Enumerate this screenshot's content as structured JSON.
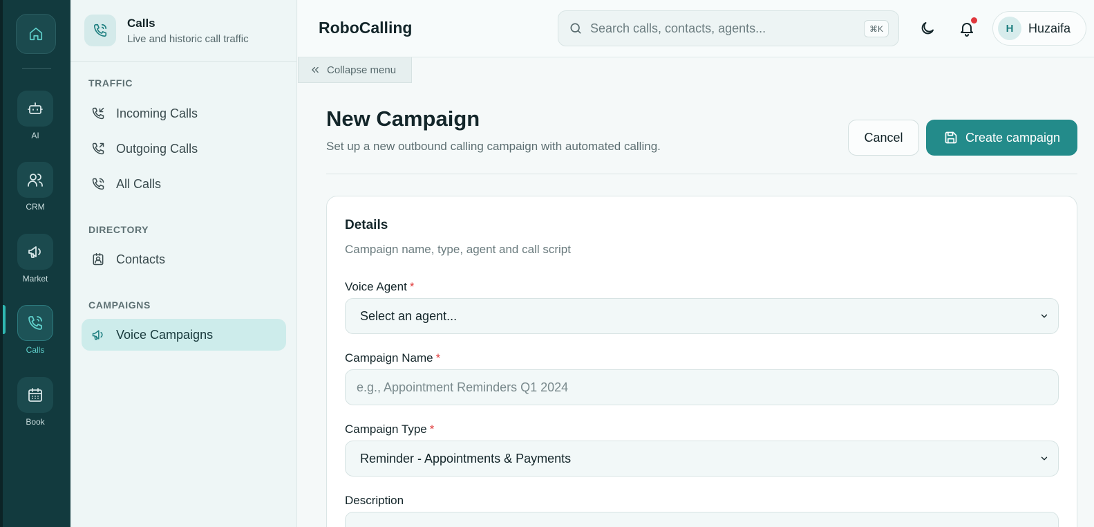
{
  "rail": {
    "items": [
      {
        "label": "",
        "icon": "home-icon"
      },
      {
        "label": "AI",
        "icon": "bot-icon"
      },
      {
        "label": "CRM",
        "icon": "users-icon"
      },
      {
        "label": "Market",
        "icon": "megaphone-icon"
      },
      {
        "label": "Calls",
        "icon": "phone-icon",
        "active": true
      },
      {
        "label": "Book",
        "icon": "calendar-icon"
      }
    ]
  },
  "subnav": {
    "title": "Calls",
    "subtitle": "Live and historic call traffic",
    "sections": [
      {
        "label": "TRAFFIC",
        "items": [
          {
            "label": "Incoming Calls",
            "icon": "phone-incoming-icon"
          },
          {
            "label": "Outgoing Calls",
            "icon": "phone-outgoing-icon"
          },
          {
            "label": "All Calls",
            "icon": "phone-call-icon"
          }
        ]
      },
      {
        "label": "DIRECTORY",
        "items": [
          {
            "label": "Contacts",
            "icon": "contact-icon"
          }
        ]
      },
      {
        "label": "CAMPAIGNS",
        "items": [
          {
            "label": "Voice Campaigns",
            "icon": "megaphone-icon",
            "active": true
          }
        ]
      }
    ]
  },
  "topbar": {
    "app_title": "RoboCalling",
    "search_placeholder": "Search calls, contacts, agents...",
    "search_shortcut": "⌘K",
    "user_initial": "H",
    "user_name": "Huzaifa"
  },
  "collapse_label": "Collapse menu",
  "page": {
    "title": "New Campaign",
    "subtitle": "Set up a new outbound calling campaign with automated calling.",
    "cancel_label": "Cancel",
    "create_label": "Create campaign"
  },
  "details": {
    "title": "Details",
    "subtitle": "Campaign name, type, agent and call script",
    "voice_agent_label": "Voice Agent",
    "voice_agent_value": "Select an agent...",
    "campaign_name_label": "Campaign Name",
    "campaign_name_placeholder": "e.g., Appointment Reminders Q1 2024",
    "campaign_type_label": "Campaign Type",
    "campaign_type_value": "Reminder - Appointments & Payments",
    "description_label": "Description",
    "required_marker": "*"
  },
  "colors": {
    "rail_bg": "#123a3e",
    "accent": "#238b8a",
    "active_nav_bg": "#cdeceb",
    "notification": "#e0373d",
    "required": "#e03c3c"
  }
}
